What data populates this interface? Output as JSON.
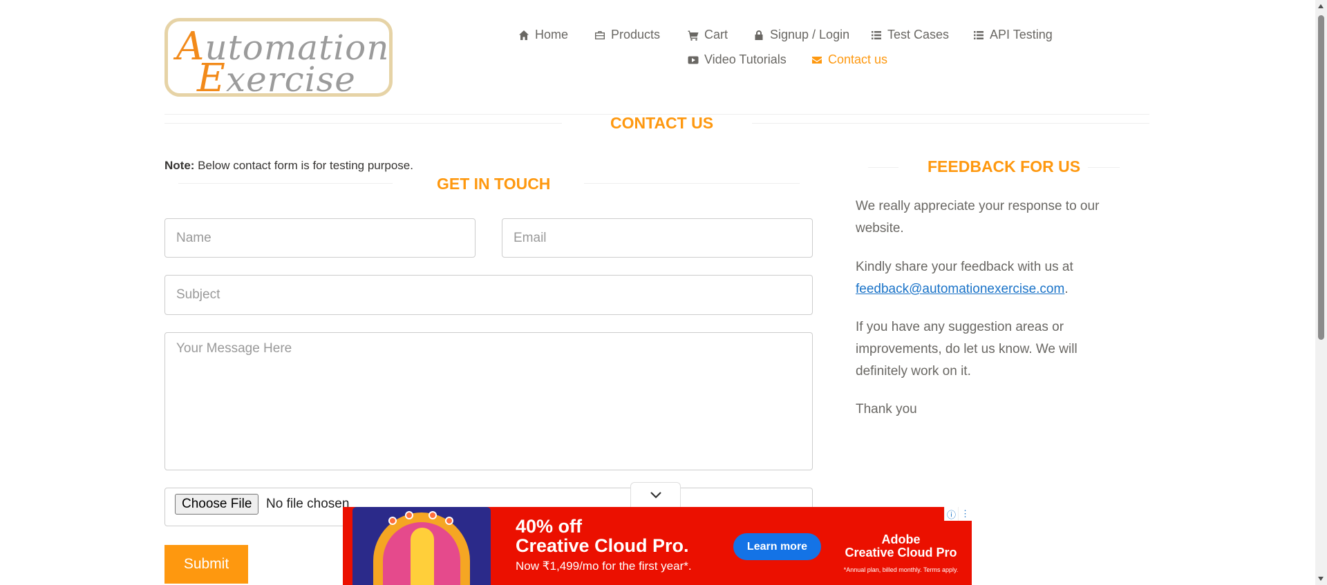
{
  "logo": {
    "line1_cap": "A",
    "line1_rest": "utomation",
    "line2_cap": "E",
    "line2_rest": "xercise"
  },
  "nav": {
    "home": "Home",
    "products": "Products",
    "cart": "Cart",
    "signup_login": "Signup / Login",
    "test_cases": "Test Cases",
    "api_testing": "API Testing",
    "video_tutorials": "Video Tutorials",
    "contact_us": "Contact us"
  },
  "page_title": "CONTACT US",
  "note": {
    "label": "Note:",
    "text": " Below contact form is for testing purpose."
  },
  "get_in_touch": "GET IN TOUCH",
  "form": {
    "name_placeholder": "Name",
    "email_placeholder": "Email",
    "subject_placeholder": "Subject",
    "message_placeholder": "Your Message Here",
    "choose_file": "Choose File",
    "no_file": "No file chosen",
    "submit": "Submit"
  },
  "feedback": {
    "title": "FEEDBACK FOR US",
    "p1": "We really appreciate your response to our website.",
    "p2_text": "Kindly share your feedback with us at ",
    "p2_link": "feedback@automationexercise.com",
    "p2_end": ".",
    "p3": "If you have any suggestion areas or improvements, do let us know. We will definitely work on it.",
    "p4": "Thank you"
  },
  "ad": {
    "headline1": "40% off",
    "headline2": "Creative Cloud Pro.",
    "subline": "Now ₹1,499/mo for the first year*.",
    "cta": "Learn more",
    "brand1": "Adobe",
    "brand2": "Creative Cloud Pro",
    "fine_print": "*Annual plan, billed monthly. Terms apply.",
    "info_icon": "ⓘ",
    "menu_icon": "⋮"
  },
  "colors": {
    "accent": "#fe980f",
    "ad_red": "#eb1000",
    "link": "#1a73c8"
  }
}
